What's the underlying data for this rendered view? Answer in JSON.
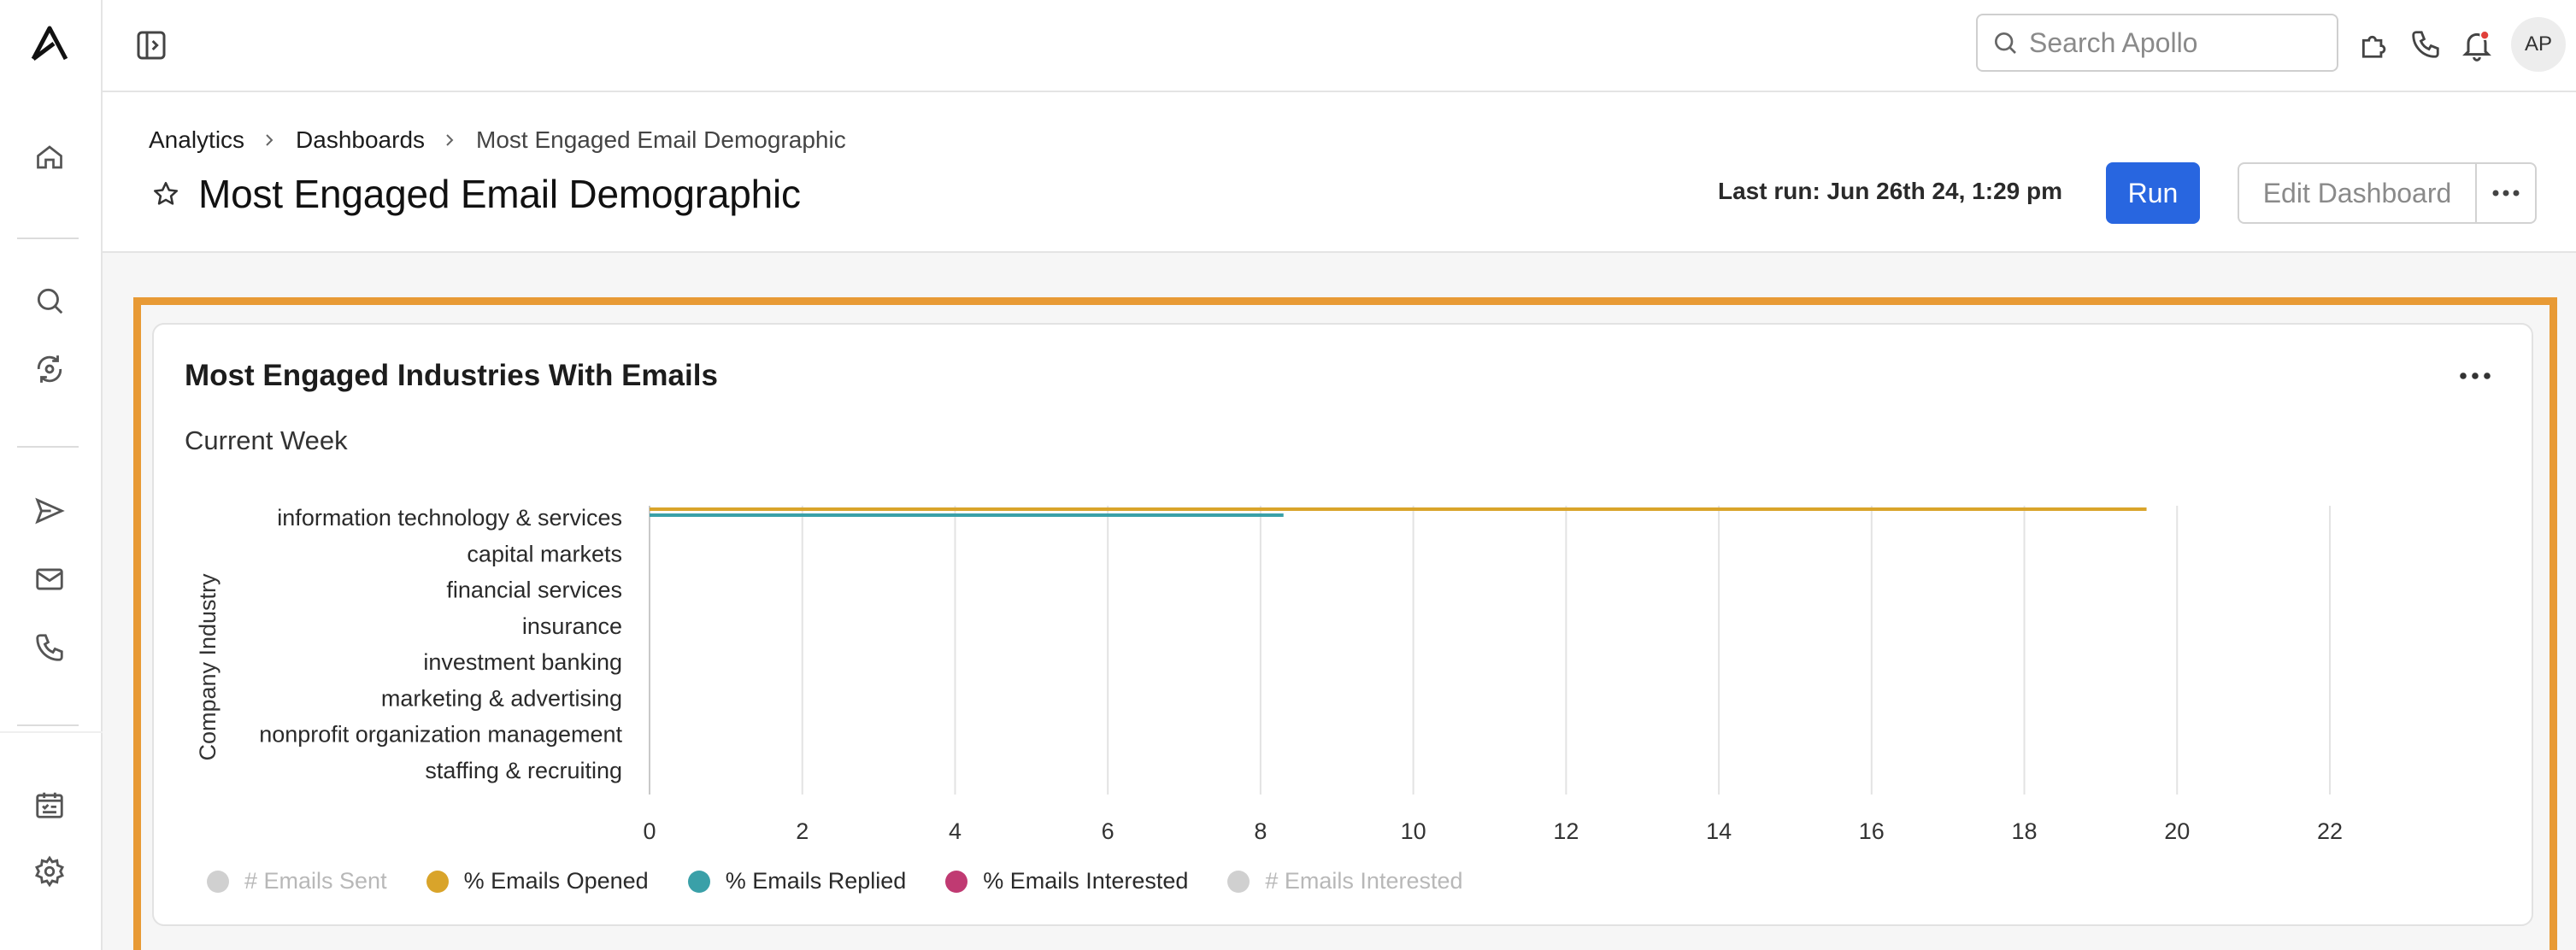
{
  "topbar": {
    "search_placeholder": "Search Apollo",
    "avatar_initials": "AP"
  },
  "breadcrumb": {
    "items": [
      "Analytics",
      "Dashboards",
      "Most Engaged Email Demographic"
    ]
  },
  "page": {
    "title": "Most Engaged Email Demographic",
    "last_run": "Last run: Jun 26th 24, 1:29 pm",
    "run_label": "Run",
    "edit_label": "Edit Dashboard"
  },
  "card": {
    "title": "Most Engaged Industries With Emails",
    "subtitle": "Current Week"
  },
  "chart_data": {
    "type": "bar",
    "orientation": "horizontal",
    "ylabel": "Company Industry",
    "xlabel": "",
    "xlim": [
      0,
      22
    ],
    "xticks": [
      0,
      2,
      4,
      6,
      8,
      10,
      12,
      14,
      16,
      18,
      20,
      22
    ],
    "categories": [
      "information technology & services",
      "capital markets",
      "financial services",
      "insurance",
      "investment banking",
      "marketing & advertising",
      "nonprofit organization management",
      "staffing & recruiting"
    ],
    "series": [
      {
        "name": "# Emails Sent",
        "color": "#d0d0d0",
        "active": false,
        "values": [
          null,
          null,
          null,
          null,
          null,
          null,
          null,
          null
        ]
      },
      {
        "name": "% Emails Opened",
        "color": "#d9a42a",
        "active": true,
        "values": [
          19.6,
          0,
          0,
          0,
          0,
          0,
          0,
          0
        ]
      },
      {
        "name": "% Emails Replied",
        "color": "#3aa0a8",
        "active": true,
        "values": [
          8.3,
          0,
          0,
          0,
          0,
          0,
          0,
          0
        ]
      },
      {
        "name": "% Emails Interested",
        "color": "#c03a72",
        "active": true,
        "values": [
          0,
          0,
          0,
          0,
          0,
          0,
          0,
          0
        ]
      },
      {
        "name": "# Emails Interested",
        "color": "#d0d0d0",
        "active": false,
        "values": [
          null,
          null,
          null,
          null,
          null,
          null,
          null,
          null
        ]
      }
    ],
    "grid": true,
    "legend_position": "bottom-left"
  }
}
